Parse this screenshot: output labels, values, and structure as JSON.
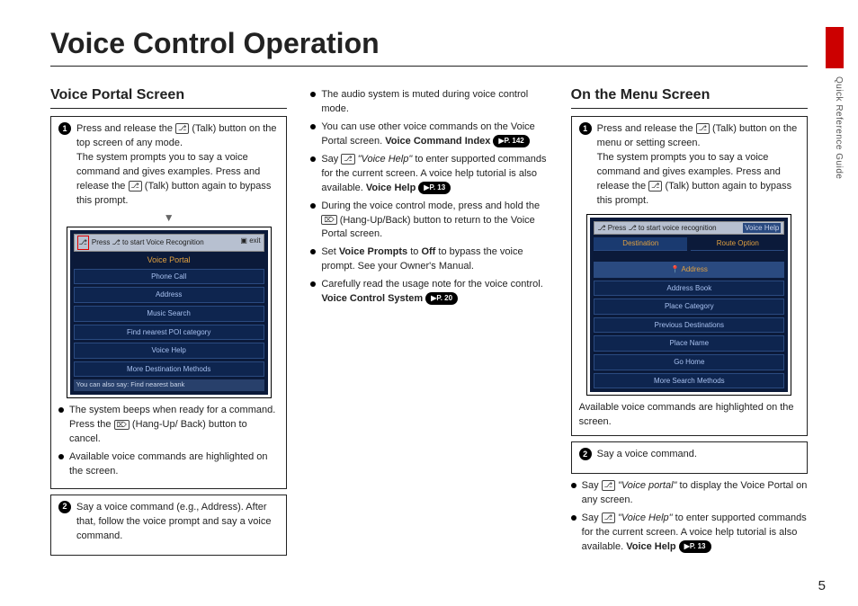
{
  "sidetab": "Quick Reference Guide",
  "title": "Voice Control Operation",
  "page_number": "5",
  "col1": {
    "heading": "Voice Portal Screen",
    "step1_a": "Press and release the",
    "talk_icon": "⎇",
    "talk_name": "(Talk)",
    "step1_b": "button on the top screen of any mode.",
    "step1_c1": "The system prompts you to say a voice command and gives examples. Press and release the",
    "step1_c2": "(Talk) button again to bypass this prompt.",
    "screen": {
      "bar_left": "Press ⎇ to start Voice Recognition",
      "bar_right": "▣  exit",
      "title": "Voice Portal",
      "buttons": [
        "Phone Call",
        "Address",
        "Music Search",
        "Find nearest POI category",
        "Voice Help",
        "More Destination Methods"
      ],
      "note": "You can also say: Find nearest bank"
    },
    "bul1_a": "The system beeps when ready for a command. Press the",
    "hang_icon": "⌦",
    "hang_name": "(Hang-Up/ Back)",
    "bul1_b": "button to cancel.",
    "bul2": "Available voice commands are highlighted on the screen.",
    "step2": "Say a voice command (e.g., Address). After that, follow the voice prompt and say a voice command."
  },
  "col2": {
    "b1": "The audio system is muted during voice control mode.",
    "b2_a": "You can use other voice commands on the Voice Portal screen.",
    "b2_bold": "Voice Command Index",
    "b2_pill": "▶P. 142",
    "b3_a": "Say",
    "vh_it": "\"Voice Help\"",
    "b3_b": "to enter supported commands for the current screen. A voice help tutorial is also available.",
    "b3_bold": "Voice Help",
    "b3_pill": "▶P. 13",
    "b4_a": "During the voice control mode, press and hold the",
    "b4_b": "(Hang-Up/Back) button to return to the Voice Portal screen.",
    "b5_a": "Set",
    "b5_bold1": "Voice Prompts",
    "b5_mid": "to",
    "b5_bold2": "Off",
    "b5_b": "to bypass the voice prompt. See your Owner's Manual.",
    "b6_a": "Carefully read the usage note for the voice control.",
    "b6_bold": "Voice Control System",
    "b6_pill": "▶P. 20"
  },
  "col3": {
    "heading": "On the Menu Screen",
    "step1_a": "Press and release the",
    "step1_b": "(Talk) button on the menu or setting screen.",
    "step1_c1": "The system prompts you to say a voice command and gives examples. Press and release the",
    "step1_c2": "(Talk) button again to bypass this prompt.",
    "screen": {
      "bar_left": "Press ⎇ to start voice recognition",
      "bar_right": "Voice Help",
      "tabs": [
        "Destination",
        "Route Option"
      ],
      "rows": [
        [
          "",
          "Address"
        ],
        [
          "Address Book",
          "Place Category"
        ],
        [
          "Previous Destinations",
          "Place Name"
        ],
        [
          "Go Home",
          "More Search Methods"
        ]
      ],
      "address_icon": "📍"
    },
    "caption": "Available voice commands are highlighted on the screen.",
    "step2": "Say a voice command.",
    "bb1_a": "Say",
    "bb1_it": "\"Voice portal\"",
    "bb1_b": "to display the Voice Portal on any screen.",
    "bb2_a": "Say",
    "bb2_it": "\"Voice Help\"",
    "bb2_b": "to enter supported commands for the current screen. A voice help tutorial is also available.",
    "bb2_bold": "Voice Help",
    "bb2_pill": "▶P. 13"
  }
}
